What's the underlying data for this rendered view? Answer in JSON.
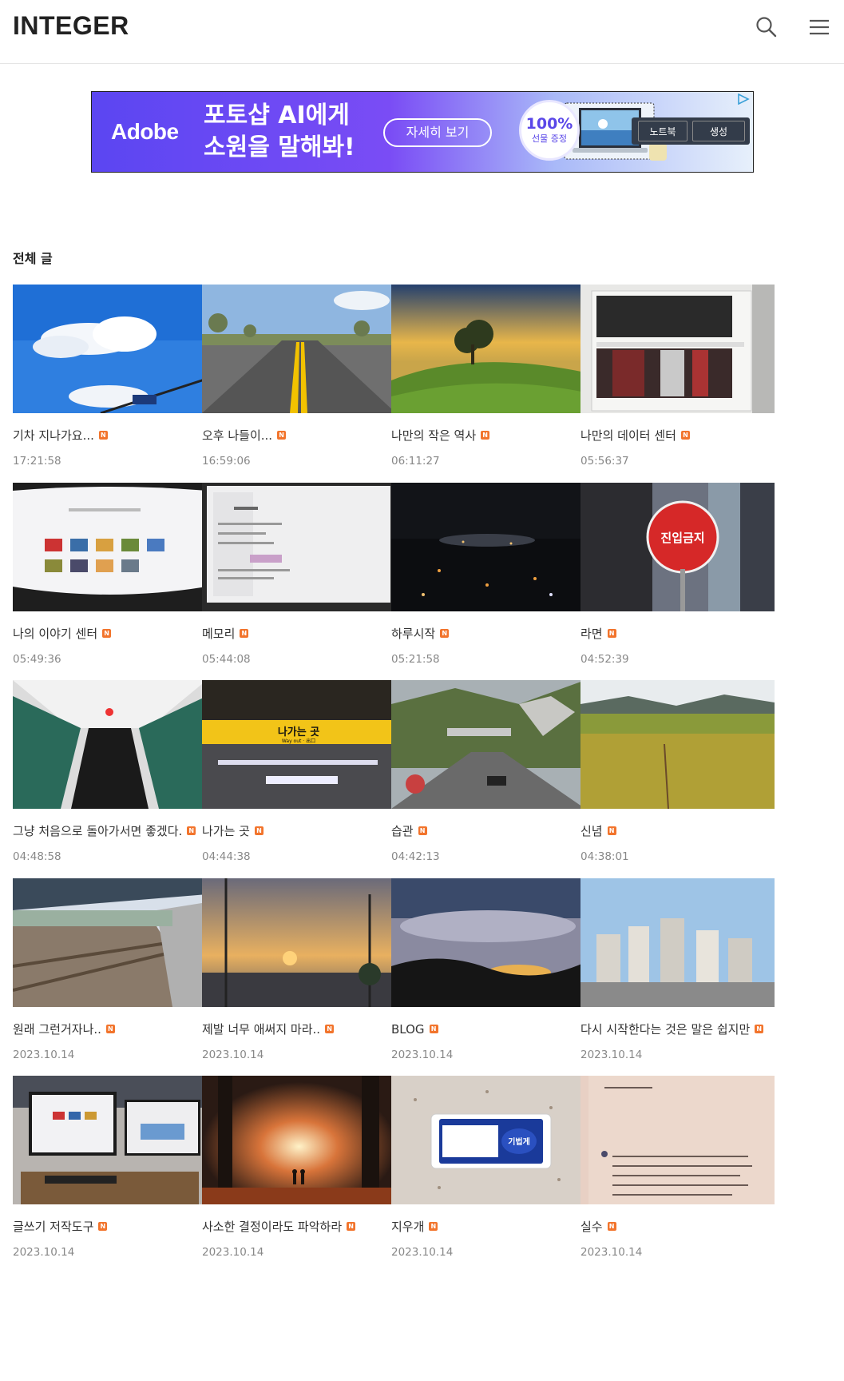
{
  "header": {
    "logo": "INTEGER"
  },
  "ad": {
    "brand": "Adobe",
    "headline_line1": "포토샵 AI에게",
    "headline_line2": "소원을 말해봐!",
    "cta": "자세히 보기",
    "badge_big": "100%",
    "badge_small": "선물 증정",
    "btn1": "노트북",
    "btn2": "생성"
  },
  "section": {
    "title": "전체 글",
    "new_badge": "N"
  },
  "posts": [
    {
      "title": "기차 지나가요...",
      "time": "17:21:58"
    },
    {
      "title": "오후 나들이...",
      "time": "16:59:06"
    },
    {
      "title": "나만의 작은 역사",
      "time": "06:11:27"
    },
    {
      "title": "나만의 데이터 센터",
      "time": "05:56:37"
    },
    {
      "title": "나의 이야기 센터",
      "time": "05:49:36"
    },
    {
      "title": "메모리",
      "time": "05:44:08"
    },
    {
      "title": "하루시작",
      "time": "05:21:58"
    },
    {
      "title": "라면",
      "time": "04:52:39"
    },
    {
      "title": "그냥 처음으로 돌아가서면 좋겠다.",
      "time": "04:48:58"
    },
    {
      "title": "나가는 곳",
      "time": "04:44:38"
    },
    {
      "title": "습관",
      "time": "04:42:13"
    },
    {
      "title": "신념",
      "time": "04:38:01"
    },
    {
      "title": "원래 그런거자나..",
      "time": "2023.10.14"
    },
    {
      "title": "제발 너무 애써지 마라..",
      "time": "2023.10.14"
    },
    {
      "title": "BLOG",
      "time": "2023.10.14"
    },
    {
      "title": "다시 시작한다는 것은 말은 쉽지만",
      "time": "2023.10.14"
    },
    {
      "title": "글쓰기 저작도구",
      "time": "2023.10.14"
    },
    {
      "title": "사소한 결정이라도 파악하라",
      "time": "2023.10.14"
    },
    {
      "title": "지우개",
      "time": "2023.10.14"
    },
    {
      "title": "실수",
      "time": "2023.10.14"
    }
  ],
  "thumb_text": {
    "sign_stop": "진입금지",
    "sign_exit": "나가는 곳",
    "sign_exit_sub": "Way out · 出口",
    "eraser_label": "기법게"
  },
  "colors": {
    "accent": "#f2742c",
    "ad_purple": "#5b46f2"
  }
}
